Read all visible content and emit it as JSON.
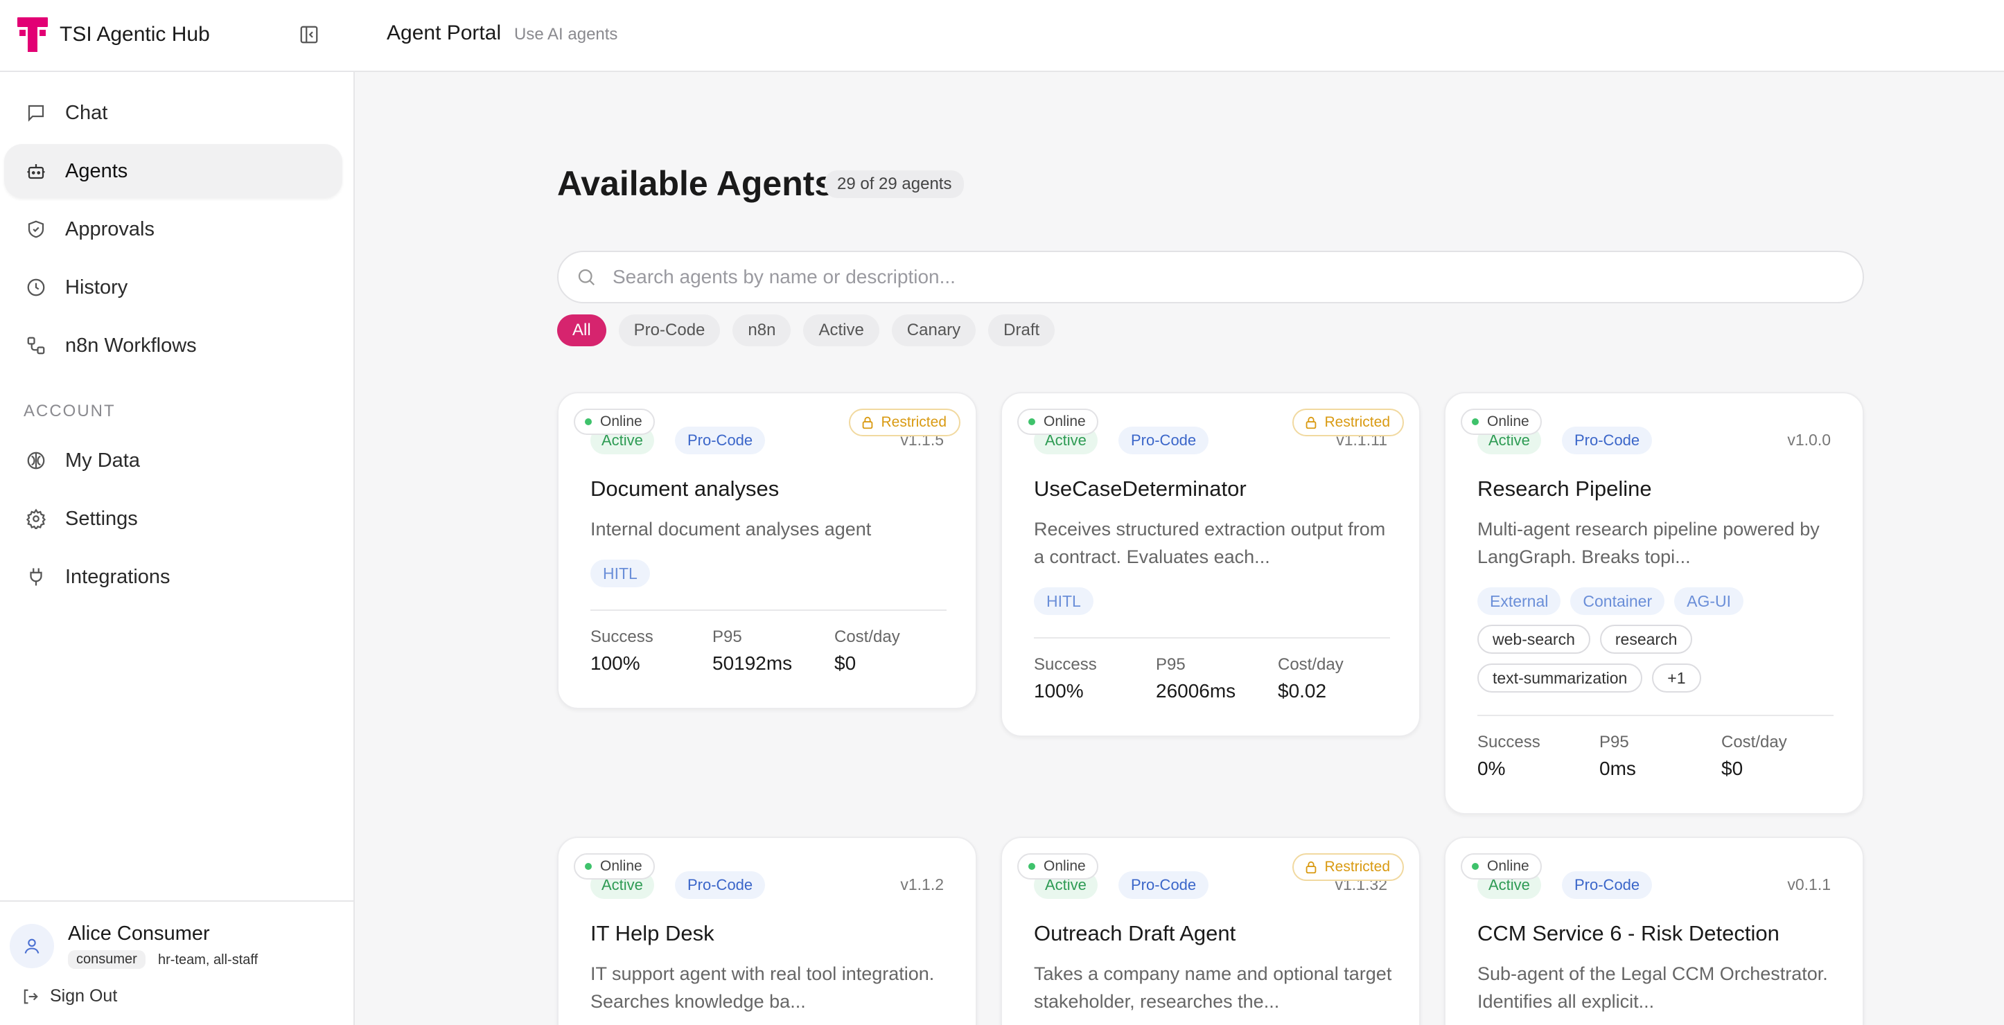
{
  "header": {
    "brand_name": "TSI Agentic Hub",
    "portal_title": "Agent Portal",
    "portal_subtitle": "Use AI agents",
    "accent_color": "#e20074"
  },
  "sidebar": {
    "items": [
      {
        "label": "Chat",
        "icon": "chat-icon"
      },
      {
        "label": "Agents",
        "icon": "bot-icon",
        "active": true
      },
      {
        "label": "Approvals",
        "icon": "shield-check-icon"
      },
      {
        "label": "History",
        "icon": "clock-icon"
      },
      {
        "label": "n8n Workflows",
        "icon": "workflow-icon"
      }
    ],
    "account_label": "ACCOUNT",
    "account_items": [
      {
        "label": "My Data",
        "icon": "brain-icon"
      },
      {
        "label": "Settings",
        "icon": "gear-icon"
      },
      {
        "label": "Integrations",
        "icon": "plug-icon"
      }
    ],
    "user": {
      "name": "Alice Consumer",
      "role": "consumer",
      "groups": "hr-team, all-staff"
    },
    "signout_label": "Sign Out"
  },
  "main": {
    "title": "Available Agents",
    "count": "29 of 29 agents",
    "search_placeholder": "Search agents by name or description...",
    "filters": [
      "All",
      "Pro-Code",
      "n8n",
      "Active",
      "Canary",
      "Draft"
    ],
    "active_filter": "All",
    "metric_labels": {
      "success": "Success",
      "p95": "P95",
      "cost": "Cost/day"
    }
  },
  "agents": [
    {
      "status": "Online",
      "lifecycle": "Active",
      "type": "Pro-Code",
      "version": "v1.1.5",
      "restricted": "Restricted",
      "name": "Document analyses",
      "description": "Internal document analyses agent",
      "tags": [
        "HITL"
      ],
      "outline_tags": [],
      "success": "100%",
      "p95": "50192ms",
      "cost": "$0"
    },
    {
      "status": "Online",
      "lifecycle": "Active",
      "type": "Pro-Code",
      "version": "v1.1.11",
      "restricted": "Restricted",
      "name": "UseCaseDeterminator",
      "description": "Receives structured extraction output from a contract. Evaluates each...",
      "tags": [
        "HITL"
      ],
      "outline_tags": [],
      "success": "100%",
      "p95": "26006ms",
      "cost": "$0.02"
    },
    {
      "status": "Online",
      "lifecycle": "Active",
      "type": "Pro-Code",
      "version": "v1.0.0",
      "restricted": "",
      "name": "Research Pipeline",
      "description": "Multi-agent research pipeline powered by LangGraph. Breaks topi...",
      "tags": [
        "External",
        "Container",
        "AG-UI"
      ],
      "outline_tags": [
        "web-search",
        "research",
        "text-summarization",
        "+1"
      ],
      "success": "0%",
      "p95": "0ms",
      "cost": "$0"
    },
    {
      "status": "Online",
      "lifecycle": "Active",
      "type": "Pro-Code",
      "version": "v1.1.2",
      "restricted": "",
      "name": "IT Help Desk",
      "description": "IT support agent with real tool integration. Searches knowledge ba..."
    },
    {
      "status": "Online",
      "lifecycle": "Active",
      "type": "Pro-Code",
      "version": "v1.1.32",
      "restricted": "Restricted",
      "name": "Outreach Draft Agent",
      "description": "Takes a company name and optional target stakeholder, researches the..."
    },
    {
      "status": "Online",
      "lifecycle": "Active",
      "type": "Pro-Code",
      "version": "v0.1.1",
      "restricted": "",
      "name": "CCM Service 6 - Risk Detection",
      "description": "Sub-agent of the Legal CCM Orchestrator. Identifies all explicit..."
    }
  ]
}
